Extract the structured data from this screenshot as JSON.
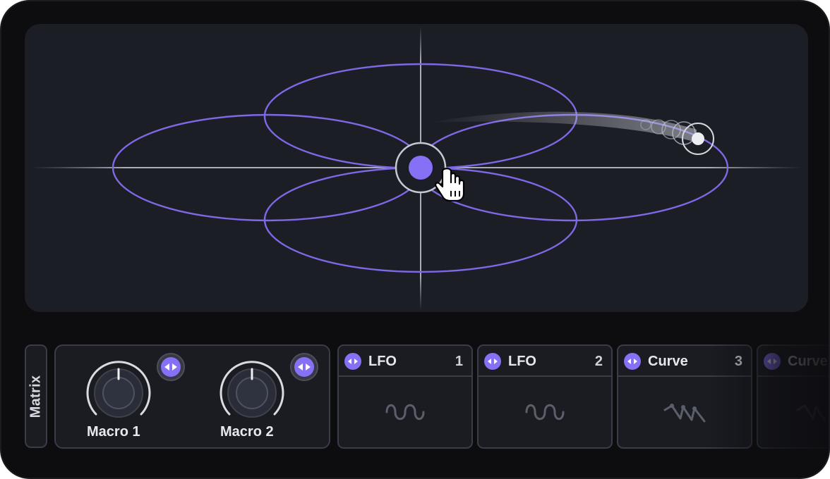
{
  "matrix_tab": {
    "label": "Matrix"
  },
  "macros": [
    {
      "label": "Macro 1",
      "mod_icon": "bidirectional-arrows-icon"
    },
    {
      "label": "Macro 2",
      "mod_icon": "bidirectional-arrows-icon"
    }
  ],
  "modulators": [
    {
      "name": "LFO",
      "number": "1",
      "icon": "bidirectional-arrows-icon",
      "shape": "sine-wave-icon"
    },
    {
      "name": "LFO",
      "number": "2",
      "icon": "bidirectional-arrows-icon",
      "shape": "sine-wave-icon"
    },
    {
      "name": "Curve",
      "number": "3",
      "icon": "bidirectional-arrows-icon",
      "shape": "curve-shape-icon"
    },
    {
      "name": "Curve",
      "number": "",
      "icon": "bidirectional-arrows-icon",
      "shape": "curve-shape-icon"
    }
  ],
  "colors": {
    "accent": "#8670f5",
    "orbit": "#7e68e6",
    "pad_background": "#1c1e25",
    "frame_background": "#0d0d10",
    "panel_border": "#3a3d47"
  }
}
